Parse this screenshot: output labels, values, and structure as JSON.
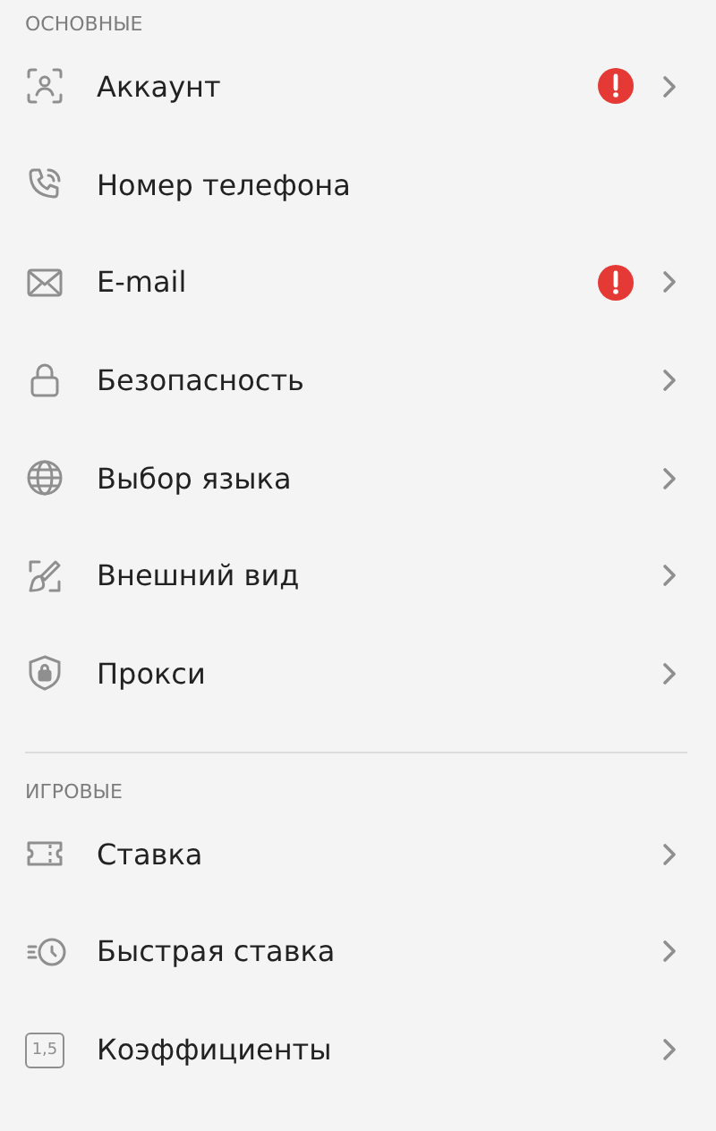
{
  "sections": [
    {
      "title": "ОСНОВНЫЕ",
      "items": [
        {
          "kind": "account",
          "label": "Аккаунт",
          "warning": true,
          "chevron": true
        },
        {
          "kind": "phone",
          "label": "Номер телефона",
          "warning": false,
          "chevron": false
        },
        {
          "kind": "mail",
          "label": "E-mail",
          "warning": true,
          "chevron": true
        },
        {
          "kind": "lock",
          "label": "Безопасность",
          "warning": false,
          "chevron": true
        },
        {
          "kind": "globe",
          "label": "Выбор языка",
          "warning": false,
          "chevron": true
        },
        {
          "kind": "brush",
          "label": "Внешний вид",
          "warning": false,
          "chevron": true
        },
        {
          "kind": "shield",
          "label": "Прокси",
          "warning": false,
          "chevron": true
        }
      ]
    },
    {
      "title": "ИГРОВЫЕ",
      "items": [
        {
          "kind": "ticket",
          "label": "Ставка",
          "warning": false,
          "chevron": true
        },
        {
          "kind": "fast",
          "label": "Быстрая ставка",
          "warning": false,
          "chevron": true
        },
        {
          "kind": "odds",
          "label": "Коэффициенты",
          "icon_text": "1,5",
          "warning": false,
          "chevron": true
        }
      ]
    }
  ]
}
